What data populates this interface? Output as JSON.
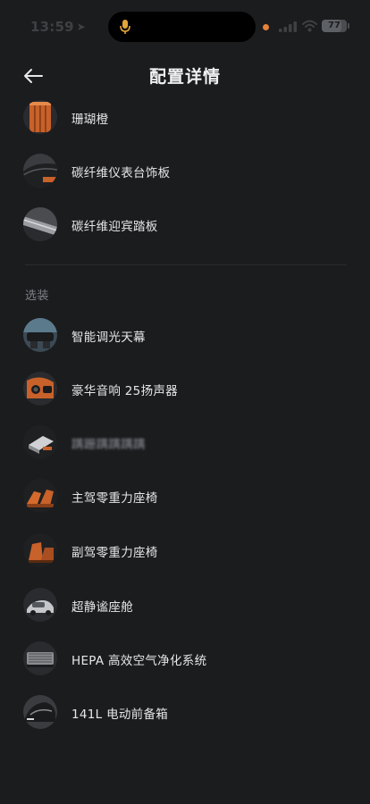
{
  "status_bar": {
    "time": "13:59",
    "battery": "77",
    "battery_level": 0.77,
    "privacy_dot_color": "#e6823a",
    "icons": [
      "navigation-arrow-icon",
      "microphone-icon",
      "signal-icon",
      "wifi-icon",
      "battery-icon"
    ]
  },
  "header": {
    "title": "配置详情",
    "back_icon": "back-arrow-icon"
  },
  "standard_items": [
    {
      "label": "珊瑚橙"
    },
    {
      "label": "碳纤维仪表台饰板"
    },
    {
      "label": "碳纤维迎宾踏板"
    }
  ],
  "optional_section": {
    "heading": "选装",
    "items": [
      {
        "label": "智能调光天幕"
      },
      {
        "label": "豪华音响 25扬声器"
      },
      {
        "label": "蹒跚蹒蹒蹒蹒"
      },
      {
        "label": "主驾零重力座椅"
      },
      {
        "label": "副驾零重力座椅"
      },
      {
        "label": "超静谧座舱"
      },
      {
        "label": "HEPA 高效空气净化系统"
      },
      {
        "label": "141L 电动前备箱"
      }
    ]
  },
  "colors": {
    "background": "#1b1c1e",
    "accent_orange": "#e6823a",
    "text_primary": "#e6e6e9",
    "text_secondary": "#7d8087"
  }
}
